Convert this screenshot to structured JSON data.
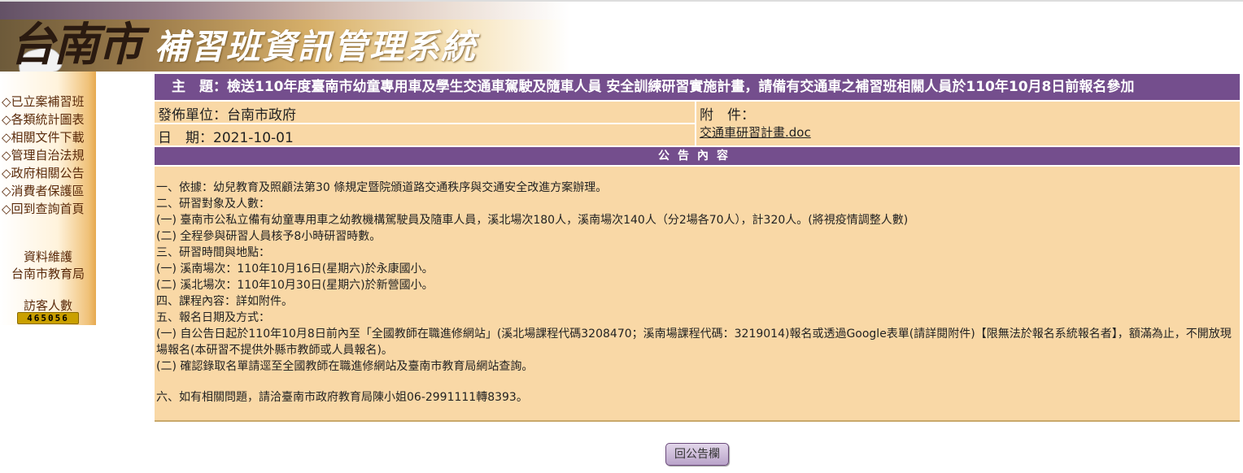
{
  "header": {
    "logo_text": "台南市",
    "system_title": "補習班資訊管理系統"
  },
  "sidebar": {
    "items": [
      {
        "label": "◇已立案補習班"
      },
      {
        "label": "◇各類統計圖表"
      },
      {
        "label": "◇相關文件下載"
      },
      {
        "label": "◇管理自治法規"
      },
      {
        "label": "◇政府相關公告"
      },
      {
        "label": "◇消費者保護區"
      },
      {
        "label": "◇回到查詢首頁"
      }
    ],
    "maintenance_title": "資料維護",
    "maintenance_org": "台南市教育局",
    "visitor_label": "訪客人數",
    "visitor_count": "465056"
  },
  "notice": {
    "subject": "　主　題：檢送110年度臺南市幼童專用車及學生交通車駕駛及隨車人員 安全訓練研習實施計畫，請備有交通車之補習班相關人員於110年10月8日前報名參加",
    "unit": "發佈單位：台南市政府",
    "date": "日　期：2021-10-01",
    "attachment_label": "附　件：",
    "attachment_file": "交通車研習計畫.doc",
    "content_header": "公告內容",
    "content_lines": [
      "一、依據：幼兒教育及照顧法第30 條規定暨院頒道路交通秩序與交通安全改進方案辦理。",
      "二、研習對象及人數：",
      " (一) 臺南市公私立備有幼童專用車之幼教機構駕駛員及隨車人員，溪北場次180人，溪南場次140人（分2場各70人），計320人。(將視疫情調整人數)",
      " (二) 全程參與研習人員核予8小時研習時數。",
      "三、研習時間與地點：",
      " (一) 溪南場次：110年10月16日(星期六)於永康國小。",
      " (二) 溪北場次：110年10月30日(星期六)於新營國小。",
      "四、課程內容：詳如附件。",
      "五、報名日期及方式：",
      "(一) 自公告日起於110年10月8日前內至「全國教師在職進修網站」(溪北場課程代碼3208470；溪南場課程代碼：3219014)報名或透過Google表單(請詳閱附件)【限無法於報名系統報名者】，額滿為止，不開放現場報名(本研習不提供外縣市教師或人員報名)。",
      "(二) 確認錄取名單請逕至全國教師在職進修網站及臺南市教育局網站查詢。"
    ],
    "contact_line": "六、如有相關問題，請洽臺南市政府教育局陳小姐06-2991111轉8393。"
  },
  "back_button": "回公告欄"
}
